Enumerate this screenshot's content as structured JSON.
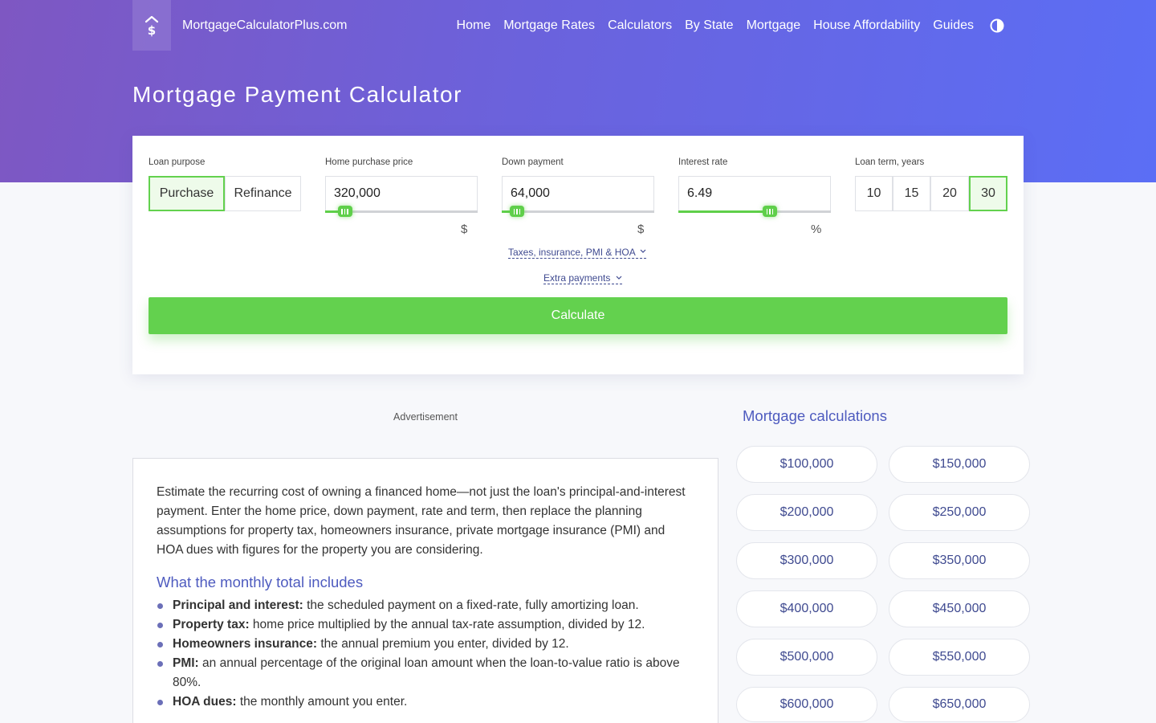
{
  "header": {
    "site_name": "MortgageCalculatorPlus.com",
    "nav": [
      "Home",
      "Mortgage Rates",
      "Calculators",
      "By State",
      "Mortgage",
      "House Affordability",
      "Guides"
    ],
    "page_title": "Mortgage Payment Calculator"
  },
  "calculator": {
    "loan_purpose": {
      "label": "Loan purpose",
      "options": [
        "Purchase",
        "Refinance"
      ],
      "selected": "Purchase"
    },
    "home_price": {
      "label": "Home purchase price",
      "value": "320,000",
      "unit": "$",
      "slider_fraction": 0.13
    },
    "down_payment": {
      "label": "Down payment",
      "value": "64,000",
      "unit": "$",
      "slider_fraction": 0.1
    },
    "interest_rate": {
      "label": "Interest rate",
      "value": "6.49",
      "unit": "%",
      "slider_fraction": 0.6
    },
    "loan_term": {
      "label": "Loan term, years",
      "options": [
        "10",
        "15",
        "20",
        "30"
      ],
      "selected": "30"
    },
    "taxes_link": "Taxes, insurance, PMI & HOA",
    "extra_link": "Extra payments",
    "calculate_label": "Calculate"
  },
  "advertisement_label": "Advertisement",
  "article": {
    "intro": "Estimate the recurring cost of owning a financed home—not just the loan's principal-and-interest payment. Enter the home price, down payment, rate and term, then replace the planning assumptions for property tax, homeowners insurance, private mortgage insurance (PMI) and HOA dues with figures for the property you are considering.",
    "heading": "What the monthly total includes",
    "items": [
      {
        "term": "Principal and interest:",
        "text": " the scheduled payment on a fixed-rate, fully amortizing loan."
      },
      {
        "term": "Property tax:",
        "text": " home price multiplied by the annual tax-rate assumption, divided by 12."
      },
      {
        "term": "Homeowners insurance:",
        "text": " the annual premium you enter, divided by 12."
      },
      {
        "term": "PMI:",
        "text": " an annual percentage of the original loan amount when the loan-to-value ratio is above 80%."
      },
      {
        "term": "HOA dues:",
        "text": " the monthly amount you enter."
      }
    ]
  },
  "sidebar": {
    "title": "Mortgage calculations",
    "amounts": [
      "$100,000",
      "$150,000",
      "$200,000",
      "$250,000",
      "$300,000",
      "$350,000",
      "$400,000",
      "$450,000",
      "$500,000",
      "$550,000",
      "$600,000",
      "$650,000"
    ]
  },
  "colors": {
    "accent_green": "#63d14e",
    "link_blue": "#4e5bbf",
    "hero_start": "#7e57c2",
    "hero_end": "#5b6ef5"
  },
  "icons": {
    "logo": "house-dollar-icon",
    "theme": "contrast-icon",
    "chevron": "chevron-down-icon"
  }
}
